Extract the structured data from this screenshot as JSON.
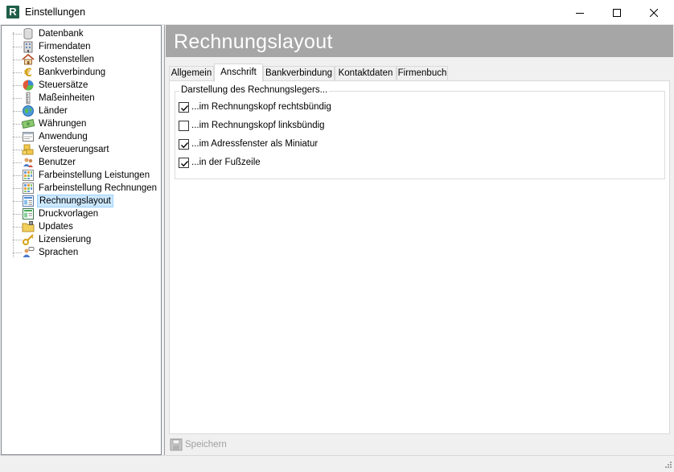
{
  "window": {
    "title": "Einstellungen",
    "icon_letter": "R"
  },
  "tree": {
    "items": [
      {
        "label": "Datenbank",
        "icon": "database-icon"
      },
      {
        "label": "Firmendaten",
        "icon": "company-building-icon"
      },
      {
        "label": "Kostenstellen",
        "icon": "house-icon"
      },
      {
        "label": "Bankverbindung",
        "icon": "euro-icon"
      },
      {
        "label": "Steuersätze",
        "icon": "pie-chart-icon"
      },
      {
        "label": "Maßeinheiten",
        "icon": "measure-icon"
      },
      {
        "label": "Länder",
        "icon": "globe-icon"
      },
      {
        "label": "Währungen",
        "icon": "banknote-icon"
      },
      {
        "label": "Anwendung",
        "icon": "application-window-icon"
      },
      {
        "label": "Versteuerungsart",
        "icon": "coins-icon"
      },
      {
        "label": "Benutzer",
        "icon": "users-icon"
      },
      {
        "label": "Farbeinstellung Leistungen",
        "icon": "color-grid-icon"
      },
      {
        "label": "Farbeinstellung Rechnungen",
        "icon": "color-grid-icon"
      },
      {
        "label": "Rechnungslayout",
        "icon": "invoice-layout-icon"
      },
      {
        "label": "Druckvorlagen",
        "icon": "print-template-icon"
      },
      {
        "label": "Updates",
        "icon": "folder-update-icon"
      },
      {
        "label": "Lizensierung",
        "icon": "key-icon"
      },
      {
        "label": "Sprachen",
        "icon": "language-person-icon"
      }
    ],
    "selected_index": 13
  },
  "page": {
    "title": "Rechnungslayout"
  },
  "tabs": [
    {
      "label": "Allgemein",
      "active": false
    },
    {
      "label": "Anschrift",
      "active": true
    },
    {
      "label": "Bankverbindung",
      "active": false
    },
    {
      "label": "Kontaktdaten",
      "active": false
    },
    {
      "label": "Firmenbuch",
      "active": false
    }
  ],
  "group": {
    "legend": "Darstellung des Rechnungslegers...",
    "options": [
      {
        "label": "...im Rechnungskopf rechtsbündig",
        "checked": true
      },
      {
        "label": "...im Rechnungskopf linksbündig",
        "checked": false
      },
      {
        "label": "...im Adressfenster als Miniatur",
        "checked": true
      },
      {
        "label": "...in der Fußzeile",
        "checked": true
      }
    ]
  },
  "footer": {
    "save_label": "Speichern"
  },
  "colors": {
    "header_bar": "#a6a6a6",
    "selection_bg": "#cce8ff",
    "app_icon": "#1f5e4a"
  }
}
